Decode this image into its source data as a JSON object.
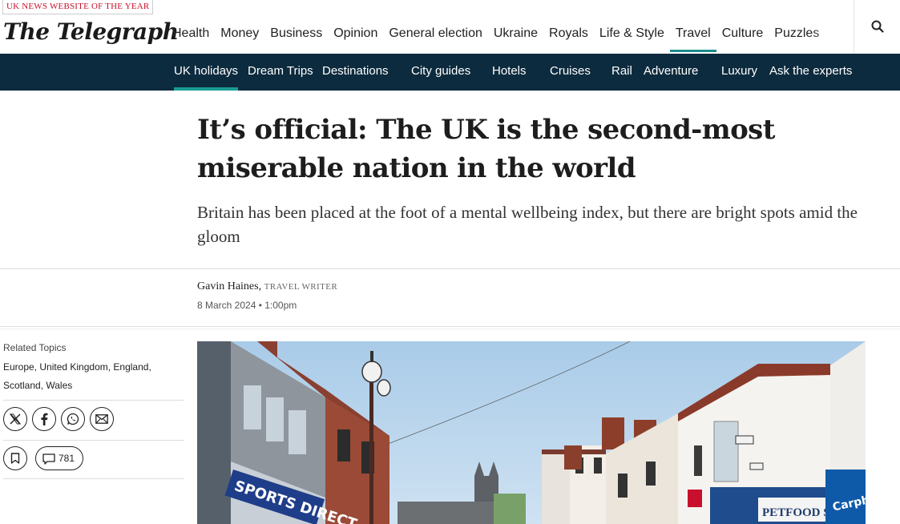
{
  "header": {
    "award": "UK NEWS WEBSITE OF THE YEAR",
    "logo": "The Telegraph",
    "nav": [
      {
        "label": "Health"
      },
      {
        "label": "Money"
      },
      {
        "label": "Business"
      },
      {
        "label": "Opinion"
      },
      {
        "label": "General election"
      },
      {
        "label": "Ukraine"
      },
      {
        "label": "Royals"
      },
      {
        "label": "Life & Style"
      },
      {
        "label": "Travel",
        "active": true
      },
      {
        "label": "Culture"
      },
      {
        "label": "Puzzles"
      }
    ],
    "search_icon": "search-icon"
  },
  "subnav": [
    {
      "label": "UK holidays",
      "active": true
    },
    {
      "label": "Dream Trips"
    },
    {
      "label": "Destinations"
    },
    {
      "label": "City guides"
    },
    {
      "label": "Hotels"
    },
    {
      "label": "Cruises"
    },
    {
      "label": "Rail"
    },
    {
      "label": "Adventure"
    },
    {
      "label": "Luxury"
    },
    {
      "label": "Ask the experts"
    }
  ],
  "article": {
    "headline": "It’s official: The UK is the second-most miserable nation in the world",
    "standfirst": "Britain has been placed at the foot of a mental wellbeing index, but there are bright spots amid the gloom",
    "author": "Gavin Haines,",
    "author_role": "Travel Writer",
    "date": "8 March 2024 • 1:00pm"
  },
  "sidebar": {
    "related_label": "Related Topics",
    "topics": "Europe, United Kingdom, England, Scotland, Wales",
    "share_icons": [
      "x-icon",
      "facebook-icon",
      "whatsapp-icon",
      "email-icon"
    ],
    "comment_count": "781"
  },
  "hero_image": {
    "shop_sign_1": "SPORTS DIRECT",
    "shop_sign_2": "PETFOOD S",
    "shop_sign_3": "Carpho"
  },
  "colors": {
    "subnav_bg": "#0d2b3e",
    "accent": "#1b8c8c",
    "award_red": "#c8102e"
  }
}
